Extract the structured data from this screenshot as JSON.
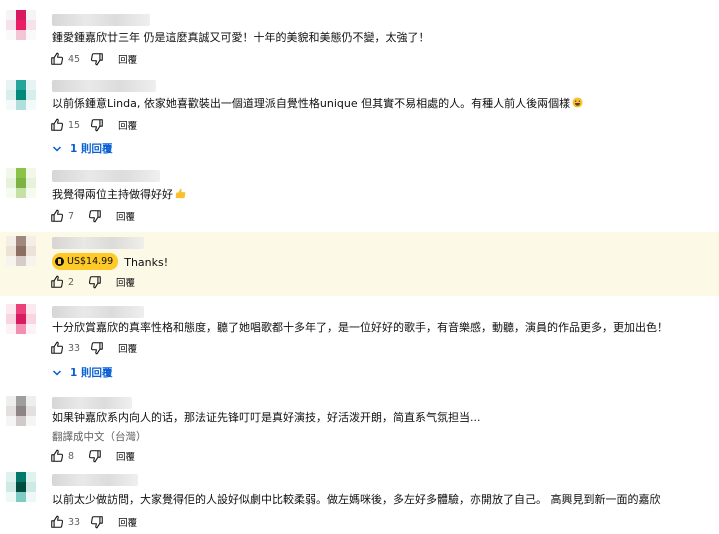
{
  "comments": [
    {
      "text": "鍾愛鍾嘉欣廿三年 仍是這麼真誠又可愛！十年的美貌和美態仍不變，太強了！",
      "likes": "45",
      "reply_label": "回覆",
      "avatar_colors": [
        "#f5f5f5",
        "#d81b60",
        "#f5f5f5",
        "#f7e1ea",
        "#e91e63",
        "#f7e1ea",
        "#fafafa",
        "#f3c5d7",
        "#fafafa"
      ]
    },
    {
      "text": "以前係鍾意Linda, 依家她喜歡裝出一個道理派自覺性格unique 但其實不易相處的人。有種人前人後兩個樣",
      "likes": "15",
      "reply_label": "回覆",
      "replies_toggle": "1 則回覆",
      "emoji": "grinning-face-emoji",
      "avatar_colors": [
        "#e6f4f3",
        "#26a69a",
        "#e6f4f3",
        "#d6eeec",
        "#00897b",
        "#d6eeec",
        "#f3faf9",
        "#b2dfdb",
        "#f3faf9"
      ]
    },
    {
      "text": "我覺得兩位主持做得好好",
      "likes": "7",
      "reply_label": "回覆",
      "emoji": "thumbs-up-emoji",
      "avatar_colors": [
        "#f1f8e9",
        "#8bc34a",
        "#f1f8e9",
        "#e6f2d9",
        "#7cb342",
        "#e6f2d9",
        "#f6fbef",
        "#c5e1a5",
        "#f6fbef"
      ]
    },
    {
      "text": "Thanks!",
      "badge": "US$14.99",
      "likes": "2",
      "reply_label": "回覆",
      "avatar_colors": [
        "#f3eee6",
        "#a1887f",
        "#f3eee6",
        "#ece3d6",
        "#8d6e63",
        "#ece3d6",
        "#f7f3ed",
        "#d7ccc8",
        "#f7f3ed"
      ]
    },
    {
      "text": "十分欣賞嘉欣的真率性格和態度，聽了她唱歌都十多年了，是一位好好的歌手，有音樂感，動聽，演員的作品更多，更加出色！",
      "likes": "33",
      "reply_label": "回覆",
      "replies_toggle": "1 則回覆",
      "avatar_colors": [
        "#fbe9ef",
        "#ec407a",
        "#fbe9ef",
        "#f8d5e1",
        "#d81b60",
        "#f8d5e1",
        "#fdf3f6",
        "#f48fb1",
        "#fdf3f6"
      ]
    },
    {
      "text": "如果钟嘉欣系内向人的话，那法证先锋叮叮是真好演技，好活泼开朗，简直系气氛担当...",
      "translate": "翻譯成中文（台灣）",
      "likes": "8",
      "reply_label": "回覆",
      "avatar_colors": [
        "#eeeeee",
        "#9e9e9e",
        "#eeeeee",
        "#e4e0e0",
        "#8d8585",
        "#e4e0e0",
        "#f5f5f5",
        "#d0caca",
        "#f5f5f5"
      ]
    },
    {
      "text": "以前太少做訪問，大家覺得佢的人設好似劇中比較柔弱。做左媽咪後，多左好多體驗，亦開放了自己。 高興見到新一面的嘉欣",
      "likes": "33",
      "reply_label": "回覆",
      "avatar_colors": [
        "#e0f2ef",
        "#00796b",
        "#e0f2ef",
        "#cfe9e4",
        "#004d40",
        "#cfe9e4",
        "#eef8f6",
        "#80cbc4",
        "#eef8f6"
      ]
    }
  ]
}
